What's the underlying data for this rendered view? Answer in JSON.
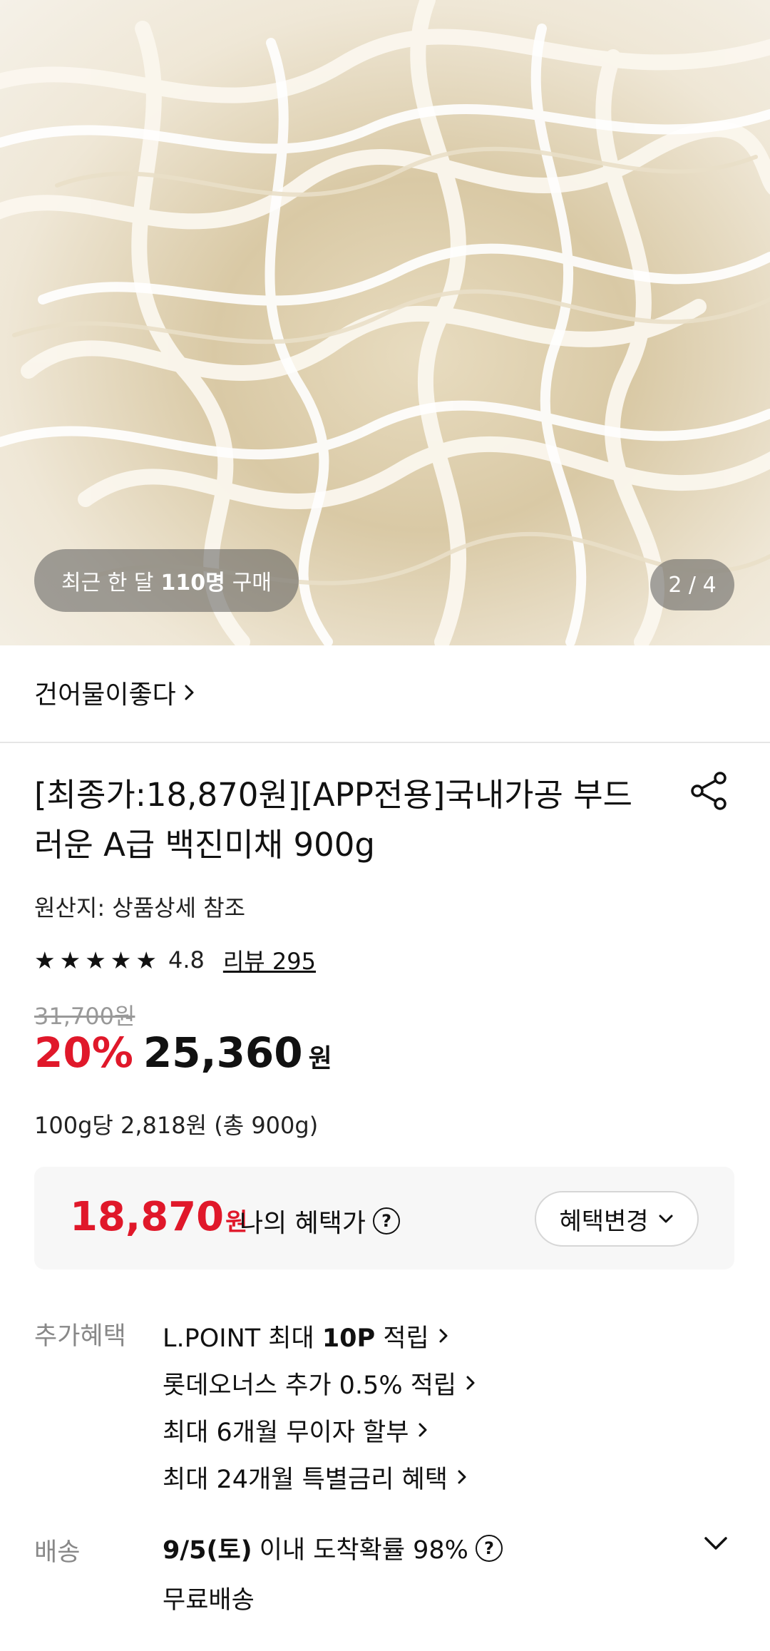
{
  "hero": {
    "recent_purchase_prefix": "최근 한 달",
    "recent_purchase_count": "110명",
    "recent_purchase_suffix": "구매",
    "page_indicator": "2 / 4"
  },
  "store": {
    "name": "건어물이좋다"
  },
  "product": {
    "title": "[최종가:18,870원][APP전용]국내가공 부드러운 A급 백진미채 900g",
    "origin": "원산지: 상품상세 참조",
    "rating": "4.8",
    "review_link": "리뷰 295",
    "stars": 5,
    "original_price": "31,700원",
    "discount": "20%",
    "sale_price": "25,360",
    "sale_unit": "원",
    "unit_price": "100g당 2,818원 (총 900g)"
  },
  "benefit": {
    "price": "18,870",
    "unit": "원",
    "label": "나의 혜택가",
    "help": "?",
    "button": "혜택변경"
  },
  "extra": {
    "label": "추가혜택",
    "items": [
      {
        "pre": "L.POINT 최대 ",
        "bold": "10P",
        "post": " 적립"
      },
      {
        "pre": "롯데오너스 추가 0.5% 적립",
        "bold": "",
        "post": ""
      },
      {
        "pre": "최대 6개월 무이자 할부",
        "bold": "",
        "post": ""
      },
      {
        "pre": "최대 24개월 특별금리 혜택",
        "bold": "",
        "post": ""
      }
    ]
  },
  "shipping": {
    "label": "배송",
    "date": "9/5(토)",
    "text": "이내 도착확률 98%",
    "help": "?",
    "fee": "무료배송"
  },
  "colors": {
    "accent_red": "#e0182a",
    "muted": "#888888"
  }
}
